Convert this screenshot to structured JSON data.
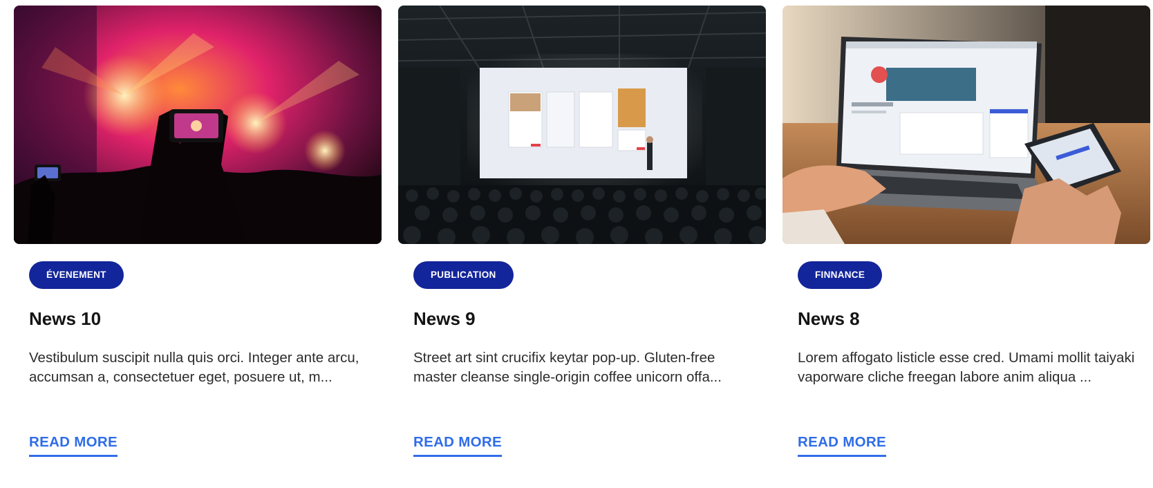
{
  "cards": [
    {
      "image": "concert-crowd-photo",
      "category": "ÉVENEMENT",
      "title": "News 10",
      "excerpt": "Vestibulum suscipit nulla quis orci. Integer ante arcu, accumsan a, consectetuer eget, posuere ut, m...",
      "read_more": "READ MORE"
    },
    {
      "image": "conference-presentation-photo",
      "category": "PUBLICATION",
      "title": "News 9",
      "excerpt": "Street art sint crucifix keytar pop-up. Gluten-free master cleanse single-origin coffee unicorn offa...",
      "read_more": "READ MORE"
    },
    {
      "image": "laptop-phone-photo",
      "category": "FINNANCE",
      "title": "News 8",
      "excerpt": "Lorem affogato listicle esse cred. Umami mollit taiyaki vaporware cliche freegan labore anim aliqua ...",
      "read_more": "READ MORE"
    }
  ],
  "colors": {
    "badge_bg": "#13259a",
    "link": "#2f6de8",
    "title": "#141414"
  }
}
